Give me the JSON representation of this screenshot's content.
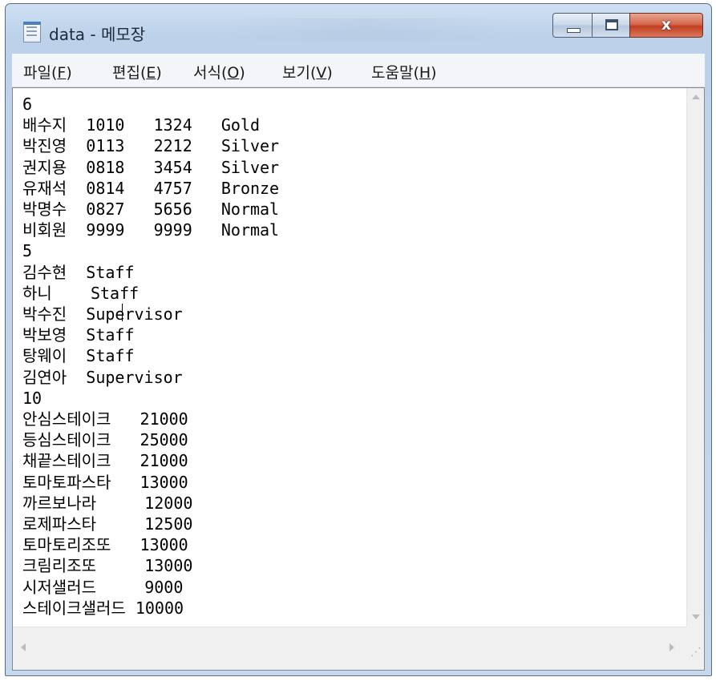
{
  "window": {
    "title": "data - 메모장",
    "minimize_symbol": "",
    "maximize_symbol": "",
    "close_symbol": "x"
  },
  "menu": [
    {
      "label": "파일(",
      "key": "F",
      "suffix": ")"
    },
    {
      "label": "편집(",
      "key": "E",
      "suffix": ")"
    },
    {
      "label": "서식(",
      "key": "O",
      "suffix": ")"
    },
    {
      "label": "보기(",
      "key": "V",
      "suffix": ")"
    },
    {
      "label": "도움말(",
      "key": "H",
      "suffix": ")"
    }
  ],
  "editor": {
    "content": "6\n배수지  1010   1324   Gold\n박진영  0113   2212   Silver\n권지용  0818   3454   Silver\n유재석  0814   4757   Bronze\n박명수  0827   5656   Normal\n비회원  9999   9999   Normal\n5\n김수현  Staff\n하니    Staff\n박수진  Supervisor\n박보영  Staff\n탕웨이  Staff\n김연아  Supervisor\n10\n안심스테이크   21000\n등심스테이크   25000\n채끝스테이크   21000\n토마토파스타   13000\n까르보나라     12000\n로제파스타     12500\n토마토리조또   13000\n크림리조또     13000\n시저샐러드     9000\n스테이크샐러드 10000"
  },
  "icons": {
    "app": "notepad-icon",
    "scroll_up": "scroll-up-arrow-icon",
    "scroll_down": "scroll-down-arrow-icon",
    "scroll_left": "scroll-left-arrow-icon",
    "scroll_right": "scroll-right-arrow-icon",
    "resize": "resize-grip-icon"
  },
  "colors": {
    "title_bar": "#c6d8ec",
    "close_button": "#c9492b",
    "editor_background": "#ffffff"
  }
}
